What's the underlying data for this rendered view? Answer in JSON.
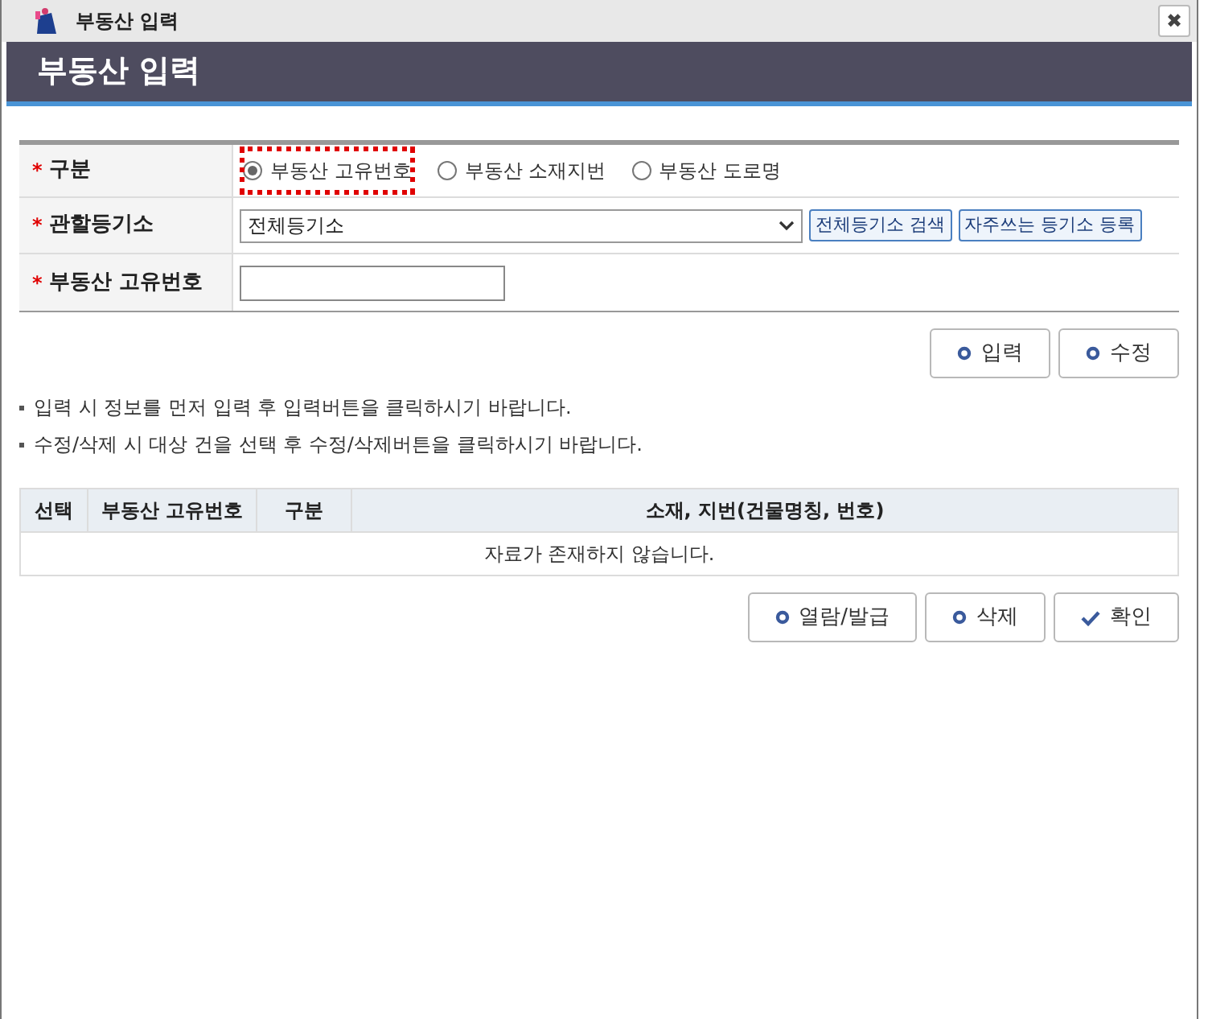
{
  "window": {
    "title": "부동산 입력",
    "close": "✖"
  },
  "header": {
    "title": "부동산 입력"
  },
  "form": {
    "type_row": {
      "label": "구분",
      "required_mark": "*",
      "options": [
        {
          "label": "부동산 고유번호",
          "selected": true
        },
        {
          "label": "부동산 소재지번",
          "selected": false
        },
        {
          "label": "부동산 도로명",
          "selected": false
        }
      ]
    },
    "registry_row": {
      "label": "관할등기소",
      "required_mark": "*",
      "value": "전체등기소",
      "buttons": [
        "전체등기소 검색",
        "자주쓰는 등기소 등록"
      ]
    },
    "number_row": {
      "label": "부동산 고유번호",
      "required_mark": "*"
    }
  },
  "actions_top": [
    "입력",
    "수정"
  ],
  "notes": [
    "입력 시 정보를 먼저 입력 후 입력버튼을 클릭하시기 바랍니다.",
    "수정/삭제 시 대상 건을 선택 후 수정/삭제버튼을 클릭하시기 바랍니다."
  ],
  "table": {
    "columns": [
      "선택",
      "부동산 고유번호",
      "구분",
      "소재, 지번(건물명칭, 번호)"
    ],
    "empty_message": "자료가 존재하지 않습니다."
  },
  "actions_bottom": [
    {
      "label": "열람/발급",
      "kind": "circle"
    },
    {
      "label": "삭제",
      "kind": "circle"
    },
    {
      "label": "확인",
      "kind": "check"
    }
  ]
}
